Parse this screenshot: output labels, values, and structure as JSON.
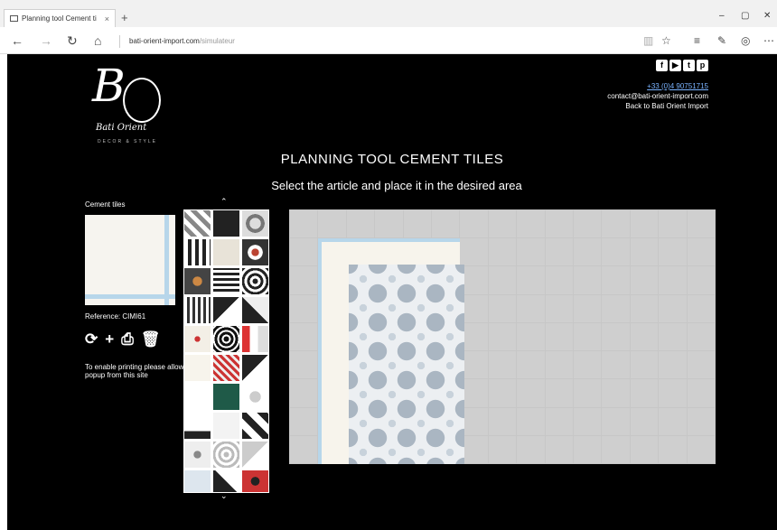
{
  "browser": {
    "tab_title": "Planning tool Cement ti",
    "tab_close": "×",
    "new_tab": "+",
    "address_host": "bati-orient-import.com",
    "address_path": "/simulateur",
    "window_controls": [
      "–",
      "▢",
      "✕"
    ]
  },
  "header": {
    "logo_text": "BO",
    "logo_script": "Bati Orient",
    "logo_tagline": "DECOR & STYLE",
    "social": [
      "f",
      "▶",
      "t",
      "p"
    ],
    "phone": "+33 (0)4 90751715",
    "email": "contact@bati-orient-import.com",
    "back_link": "Back to Bati Orient Import"
  },
  "main": {
    "title": "PLANNING TOOL CEMENT TILES",
    "subtitle": "Select the article and place it in the desired area",
    "tiles_label": "Cement tiles",
    "reference": "Reference: CIMI61",
    "print_note": "To enable printing please allow popup from this site",
    "scroll_up": "⌃",
    "scroll_down": "⌄"
  },
  "tool_icons": [
    "refresh-icon",
    "add-icon",
    "print-icon",
    "trash-icon"
  ],
  "colors": {
    "page_bg": "#000000",
    "grid_bg": "#cfcfcf",
    "tile_blue": "#b7d6ea",
    "tile_cream": "#f7f4ec"
  }
}
